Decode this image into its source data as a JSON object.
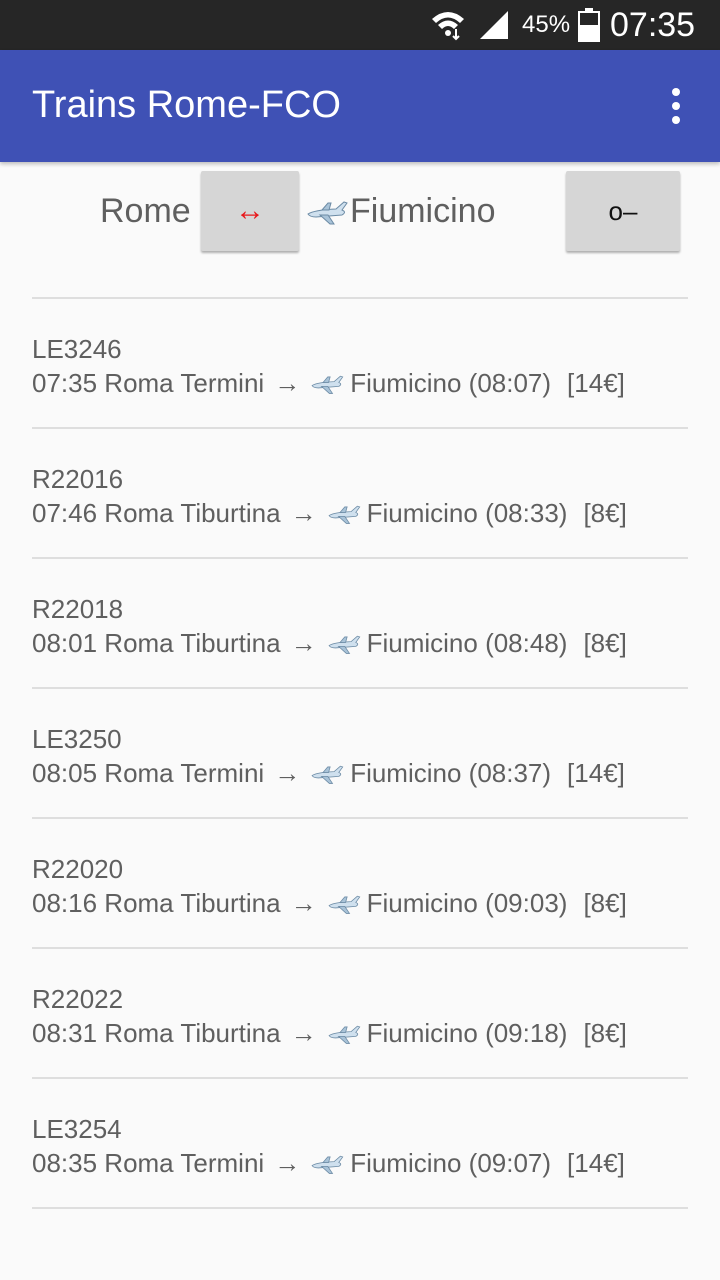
{
  "status_bar": {
    "battery_percent": "45%",
    "time": "07:35",
    "icons": [
      "wifi-icon",
      "signal-icon",
      "battery-icon"
    ]
  },
  "app_bar": {
    "title": "Trains Rome-FCO",
    "menu_icon": "overflow-menu-icon"
  },
  "route": {
    "from": "Rome",
    "swap_symbol": "↔",
    "to": "Fiumicino",
    "key_symbol": "o–"
  },
  "trains": [
    {
      "code": "LE3246",
      "departure": "07:35 Roma Termini",
      "arrow": "→",
      "destination": "Fiumicino (08:07)",
      "price": "[14€]"
    },
    {
      "code": "R22016",
      "departure": "07:46 Roma Tiburtina",
      "arrow": "→",
      "destination": "Fiumicino (08:33)",
      "price": "[8€]"
    },
    {
      "code": "R22018",
      "departure": "08:01 Roma Tiburtina",
      "arrow": "→",
      "destination": "Fiumicino (08:48)",
      "price": "[8€]"
    },
    {
      "code": "LE3250",
      "departure": "08:05 Roma Termini",
      "arrow": "→",
      "destination": "Fiumicino (08:37)",
      "price": "[14€]"
    },
    {
      "code": "R22020",
      "departure": "08:16 Roma Tiburtina",
      "arrow": "→",
      "destination": "Fiumicino (09:03)",
      "price": "[8€]"
    },
    {
      "code": "R22022",
      "departure": "08:31 Roma Tiburtina",
      "arrow": "→",
      "destination": "Fiumicino (09:18)",
      "price": "[8€]"
    },
    {
      "code": "LE3254",
      "departure": "08:35 Roma Termini",
      "arrow": "→",
      "destination": "Fiumicino (09:07)",
      "price": "[14€]"
    }
  ],
  "colors": {
    "app_bar": "#3f51b5",
    "status_bar": "#262626",
    "swap_arrow": "#e8181b",
    "text": "#5f5f5f"
  }
}
